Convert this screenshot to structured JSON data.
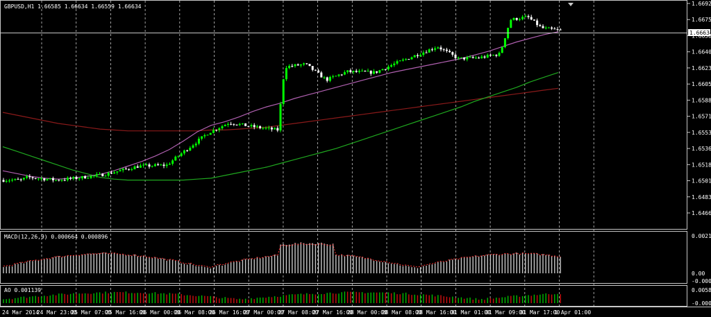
{
  "main": {
    "symbol": "GBPUSD,H1",
    "ohlc": "1.66585 1.66634 1.66559 1.66634",
    "title_text": "GBPUSD,H1  1.66585 1.66634 1.66559 1.66634",
    "price_ticks": [
      "1.66925",
      "1.66750",
      "1.66580",
      "1.66400",
      "1.66230",
      "1.66055",
      "1.65880",
      "1.65710",
      "1.65535",
      "1.65360",
      "1.65185",
      "1.65010",
      "1.64835",
      "1.64665"
    ],
    "current_price": "1.66634",
    "colors": {
      "bull": "#00ff00",
      "bear": "#ffffff",
      "grid": "#c8c8c8",
      "ma_slow": "#8b1a1a",
      "ma_mid": "#1fa81f",
      "ma_fast": "#b060b0"
    }
  },
  "macd": {
    "label": "MACD(12,26,9) 0.000664 0.000896",
    "ticks": [
      "0.002194",
      "0.00",
      "-0.000566"
    ],
    "colors": {
      "hist": "#c8c8c8",
      "signal": "#ff3030"
    }
  },
  "ao": {
    "label": "AO 0.001139",
    "ticks": [
      "0.005856",
      "-0.000856"
    ],
    "colors": {
      "up": "#00c000",
      "down": "#d01010"
    }
  },
  "time_axis": [
    "24 Mar 2014",
    "24 Mar 23:00",
    "25 Mar 07:00",
    "25 Mar 16:00",
    "26 Mar 00:00",
    "26 Mar 08:00",
    "26 Mar 16:00",
    "27 Mar 00:00",
    "27 Mar 08:00",
    "27 Mar 16:00",
    "28 Mar 00:00",
    "28 Mar 08:00",
    "28 Mar 16:00",
    "31 Mar 01:00",
    "31 Mar 09:00",
    "31 Mar 17:00",
    "1 Apr 01:00"
  ],
  "chart_data": {
    "type": "candlestick",
    "symbol": "GBPUSD",
    "timeframe": "H1",
    "ylim": [
      1.64665,
      1.66925
    ],
    "candles": [],
    "ma_fast": [
      [
        0,
        1.6512
      ],
      [
        20,
        1.6509
      ],
      [
        40,
        1.6506
      ],
      [
        60,
        1.6504
      ],
      [
        80,
        1.6503
      ],
      [
        100,
        1.6504
      ],
      [
        120,
        1.6506
      ],
      [
        140,
        1.6508
      ],
      [
        160,
        1.6512
      ],
      [
        180,
        1.6517
      ],
      [
        200,
        1.6522
      ],
      [
        220,
        1.6528
      ],
      [
        240,
        1.6535
      ],
      [
        260,
        1.6544
      ],
      [
        280,
        1.6554
      ],
      [
        300,
        1.6561
      ],
      [
        320,
        1.6565
      ],
      [
        340,
        1.657
      ],
      [
        360,
        1.6576
      ],
      [
        380,
        1.6581
      ],
      [
        400,
        1.6585
      ],
      [
        420,
        1.659
      ],
      [
        440,
        1.6594
      ],
      [
        460,
        1.6598
      ],
      [
        480,
        1.6602
      ],
      [
        500,
        1.6606
      ],
      [
        520,
        1.661
      ],
      [
        540,
        1.6614
      ],
      [
        560,
        1.6618
      ],
      [
        580,
        1.6621
      ],
      [
        600,
        1.6624
      ],
      [
        620,
        1.6627
      ],
      [
        640,
        1.663
      ],
      [
        660,
        1.6633
      ],
      [
        680,
        1.6637
      ],
      [
        700,
        1.6641
      ],
      [
        720,
        1.6646
      ],
      [
        740,
        1.6651
      ],
      [
        760,
        1.6655
      ],
      [
        780,
        1.6659
      ],
      [
        800,
        1.6662
      ]
    ],
    "ma_mid": [
      [
        0,
        1.6538
      ],
      [
        20,
        1.6533
      ],
      [
        40,
        1.6528
      ],
      [
        60,
        1.6523
      ],
      [
        80,
        1.6518
      ],
      [
        100,
        1.6513
      ],
      [
        120,
        1.6509
      ],
      [
        140,
        1.6505
      ],
      [
        160,
        1.6503
      ],
      [
        180,
        1.6502
      ],
      [
        200,
        1.6502
      ],
      [
        220,
        1.6502
      ],
      [
        240,
        1.6502
      ],
      [
        260,
        1.6502
      ],
      [
        280,
        1.6503
      ],
      [
        300,
        1.6504
      ],
      [
        320,
        1.6507
      ],
      [
        340,
        1.651
      ],
      [
        360,
        1.6513
      ],
      [
        380,
        1.6516
      ],
      [
        400,
        1.652
      ],
      [
        420,
        1.6524
      ],
      [
        440,
        1.6528
      ],
      [
        460,
        1.6532
      ],
      [
        480,
        1.6536
      ],
      [
        500,
        1.6541
      ],
      [
        520,
        1.6546
      ],
      [
        540,
        1.6551
      ],
      [
        560,
        1.6556
      ],
      [
        580,
        1.6561
      ],
      [
        600,
        1.6566
      ],
      [
        620,
        1.6571
      ],
      [
        640,
        1.6576
      ],
      [
        660,
        1.6581
      ],
      [
        680,
        1.6587
      ],
      [
        700,
        1.6592
      ],
      [
        720,
        1.6597
      ],
      [
        740,
        1.6602
      ],
      [
        760,
        1.6608
      ],
      [
        780,
        1.6613
      ],
      [
        800,
        1.6618
      ]
    ],
    "ma_slow": [
      [
        0,
        1.6575
      ],
      [
        20,
        1.6572
      ],
      [
        40,
        1.6569
      ],
      [
        60,
        1.6566
      ],
      [
        80,
        1.6563
      ],
      [
        100,
        1.6561
      ],
      [
        120,
        1.6559
      ],
      [
        140,
        1.6557
      ],
      [
        160,
        1.6556
      ],
      [
        180,
        1.6555
      ],
      [
        200,
        1.6555
      ],
      [
        220,
        1.6555
      ],
      [
        240,
        1.6555
      ],
      [
        260,
        1.6555
      ],
      [
        280,
        1.6555
      ],
      [
        300,
        1.6556
      ],
      [
        320,
        1.6556
      ],
      [
        340,
        1.6557
      ],
      [
        360,
        1.6558
      ],
      [
        380,
        1.6559
      ],
      [
        400,
        1.6561
      ],
      [
        420,
        1.6563
      ],
      [
        440,
        1.6565
      ],
      [
        460,
        1.6567
      ],
      [
        480,
        1.6569
      ],
      [
        500,
        1.6571
      ],
      [
        520,
        1.6573
      ],
      [
        540,
        1.6575
      ],
      [
        560,
        1.6577
      ],
      [
        580,
        1.6579
      ],
      [
        600,
        1.6581
      ],
      [
        620,
        1.6583
      ],
      [
        640,
        1.6585
      ],
      [
        660,
        1.6587
      ],
      [
        680,
        1.6589
      ],
      [
        700,
        1.6591
      ],
      [
        720,
        1.6593
      ],
      [
        740,
        1.6595
      ],
      [
        760,
        1.6597
      ],
      [
        780,
        1.6599
      ],
      [
        800,
        1.6601
      ]
    ]
  }
}
